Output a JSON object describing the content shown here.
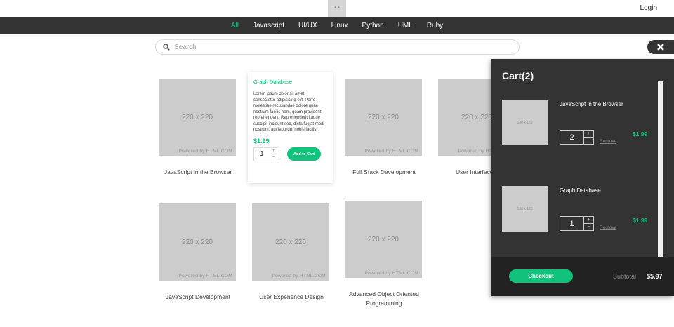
{
  "header": {
    "handle_glyph": "• •",
    "login_label": "Login"
  },
  "nav": {
    "items": [
      "All",
      "Javascript",
      "UI/UX",
      "Linux",
      "Python",
      "UML",
      "Ruby"
    ],
    "active": "All",
    "active_color": "#10c27b"
  },
  "search": {
    "placeholder": "Search",
    "value": ""
  },
  "placeholder_image": {
    "size_label": "220 x 220",
    "credit": "Powered by HTML.COM"
  },
  "products": [
    {
      "title": "JavaScript in the Browser"
    },
    {
      "title": "Full Stack Development"
    },
    {
      "title": "User Interface D"
    },
    {
      "title": "JavaScript Development"
    },
    {
      "title": "User Experience Design"
    },
    {
      "title": "Advanced Object Oriented Programming"
    }
  ],
  "expanded_card": {
    "title": "Graph Database",
    "description": "Lorem ipsum dolor sit amet consectetur adipisicing elit. Porro molestiae recusandae dolore quae nostrum facilis nam, quam provident reprehenderit! Reprehenderit itaque suscipit incidunt sed, dicta fugiat modi nostrum, aut laborum nobis facilis.",
    "price": "$1.99",
    "quantity": "1",
    "plus": "+",
    "minus": "−",
    "add_label": "Add to Cart"
  },
  "cart": {
    "title": "Cart(2)",
    "thumb_label": "130 x 130",
    "remove_label": "Remove",
    "items": [
      {
        "name": "JavaScript in the Browser",
        "quantity": "2",
        "price": "$1.99"
      },
      {
        "name": "Graph Database",
        "quantity": "1",
        "price": "$1.99"
      }
    ],
    "checkout_label": "Checkout",
    "subtotal_label": "Subtotal",
    "subtotal_value": "$5.97"
  },
  "colors": {
    "accent": "#10c27b",
    "dark": "#333333",
    "placeholder": "#cccccc"
  }
}
